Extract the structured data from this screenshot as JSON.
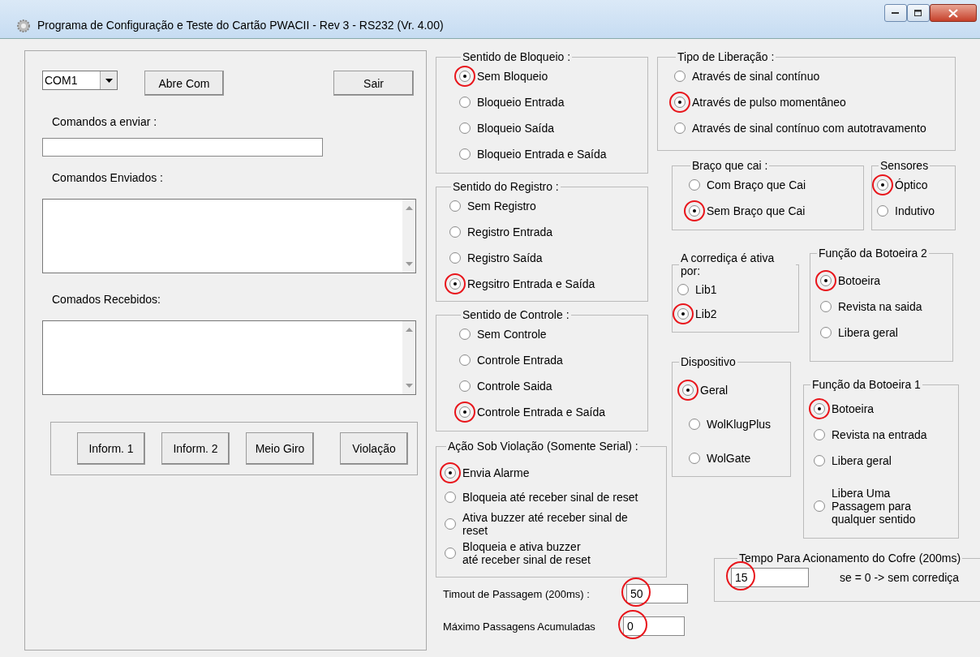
{
  "window": {
    "title": "Programa de Configuração e Teste do Cartão PWACII - Rev 3 - RS232 (Vr. 4.00)"
  },
  "left_panel": {
    "port": {
      "value": "COM1"
    },
    "open_button": "Abre Com",
    "exit_button": "Sair",
    "send_label": "Comandos a enviar :",
    "sent_label": "Comandos Enviados :",
    "received_label": "Comados Recebidos:",
    "info_buttons": [
      "Inform. 1",
      "Inform. 2",
      "Meio Giro",
      "Violação"
    ]
  },
  "middle": {
    "groups": [
      {
        "title": "Sentido de Bloqueio :",
        "options": [
          {
            "label": "Sem Bloqueio",
            "selected": true
          },
          {
            "label": "Bloqueio Entrada",
            "selected": false
          },
          {
            "label": "Bloqueio Saída",
            "selected": false
          },
          {
            "label": "Bloqueio Entrada e Saída",
            "selected": false
          }
        ]
      },
      {
        "title": "Sentido do Registro :",
        "options": [
          {
            "label": "Sem Registro",
            "selected": false
          },
          {
            "label": "Registro Entrada",
            "selected": false
          },
          {
            "label": "Registro Saída",
            "selected": false
          },
          {
            "label": "Regsitro Entrada e Saída",
            "selected": true
          }
        ]
      },
      {
        "title": "Sentido de Controle :",
        "options": [
          {
            "label": "Sem Controle",
            "selected": false
          },
          {
            "label": "Controle Entrada",
            "selected": false
          },
          {
            "label": "Controle Saida",
            "selected": false
          },
          {
            "label": "Controle Entrada e Saída",
            "selected": true
          }
        ]
      },
      {
        "title": "Ação Sob Violação (Somente Serial) :",
        "options": [
          {
            "label": "Envia Alarme",
            "selected": true
          },
          {
            "label": "Bloqueia até receber sinal de reset",
            "selected": false
          },
          {
            "label": "Ativa buzzer até receber sinal de\nreset",
            "selected": false
          },
          {
            "label": "Bloqueia e ativa buzzer\naté receber sinal de reset",
            "selected": false
          }
        ]
      }
    ],
    "timeout": {
      "label": "Timout de Passagem (200ms) :",
      "value": "50",
      "circled": true
    },
    "max_passages": {
      "label": "Máximo Passagens Acumuladas",
      "value": "0",
      "circled": true
    }
  },
  "right": {
    "release_type": {
      "title": "Tipo de Liberação :",
      "options": [
        {
          "label": "Através de sinal contínuo",
          "selected": false
        },
        {
          "label": "Através de pulso momentâneo",
          "selected": true
        },
        {
          "label": "Através de sinal contínuo com autotravamento",
          "selected": false
        }
      ]
    },
    "arm": {
      "title": "Braço que cai :",
      "options": [
        {
          "label": "Com Braço que Cai",
          "selected": false
        },
        {
          "label": "Sem Braço que Cai",
          "selected": true
        }
      ]
    },
    "sensors": {
      "title": "Sensores",
      "options": [
        {
          "label": "Óptico",
          "selected": true
        },
        {
          "label": "Indutivo",
          "selected": false
        }
      ]
    },
    "slide": {
      "title": "A corrediça é ativa por:",
      "options": [
        {
          "label": "Lib1",
          "selected": false
        },
        {
          "label": "Lib2",
          "selected": true
        }
      ]
    },
    "button2": {
      "title": "Função da Botoeira 2",
      "options": [
        {
          "label": "Botoeira",
          "selected": true
        },
        {
          "label": "Revista na saida",
          "selected": false
        },
        {
          "label": "Libera geral",
          "selected": false
        }
      ]
    },
    "device": {
      "title": "Dispositivo",
      "options": [
        {
          "label": "Geral",
          "selected": true
        },
        {
          "label": "WolKlugPlus",
          "selected": false
        },
        {
          "label": "WolGate",
          "selected": false
        }
      ]
    },
    "button1": {
      "title": "Função da Botoeira 1",
      "options": [
        {
          "label": "Botoeira",
          "selected": true
        },
        {
          "label": "Revista na entrada",
          "selected": false
        },
        {
          "label": "Libera geral",
          "selected": false
        },
        {
          "label": "Libera Uma\nPassagem para\nqualquer sentido",
          "selected": false
        }
      ]
    },
    "safe_time": {
      "title": "Tempo Para Acionamento do Cofre (200ms)",
      "value": "15",
      "circled": true,
      "note": "se = 0 -> sem corrediça"
    }
  }
}
